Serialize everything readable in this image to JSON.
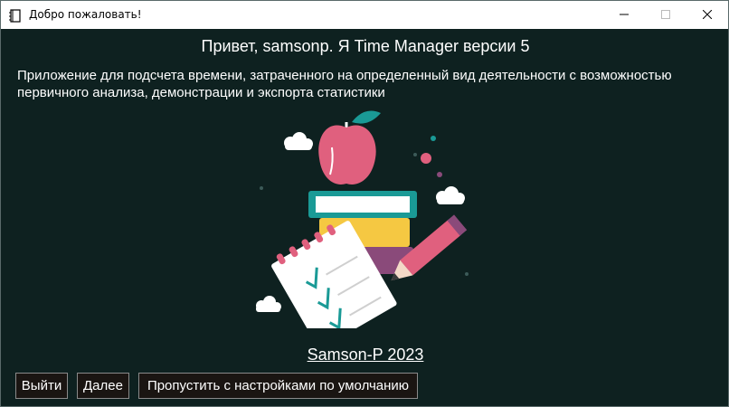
{
  "window": {
    "title": "Добро пожаловать!"
  },
  "welcome": {
    "heading": "Привет, samsonp. Я Time Manager версии 5",
    "description": "Приложение для подсчета времени, затраченного на определенный вид деятельности с возможностью первичного анализа, демонстрации и экспорта статистики",
    "credit": "Samson-P 2023"
  },
  "buttons": {
    "exit": "Выйти",
    "next": "Далее",
    "skip": "Пропустить с настройками по умолчанию"
  },
  "colors": {
    "background": "#0e2120",
    "apple": "#e0607e",
    "teal": "#1a9a96",
    "yellow": "#f5c842",
    "purple": "#8a4a7a"
  },
  "icons": {
    "app": "notebook-icon",
    "minimize": "minimize-icon",
    "maximize": "maximize-icon",
    "close": "close-icon"
  }
}
